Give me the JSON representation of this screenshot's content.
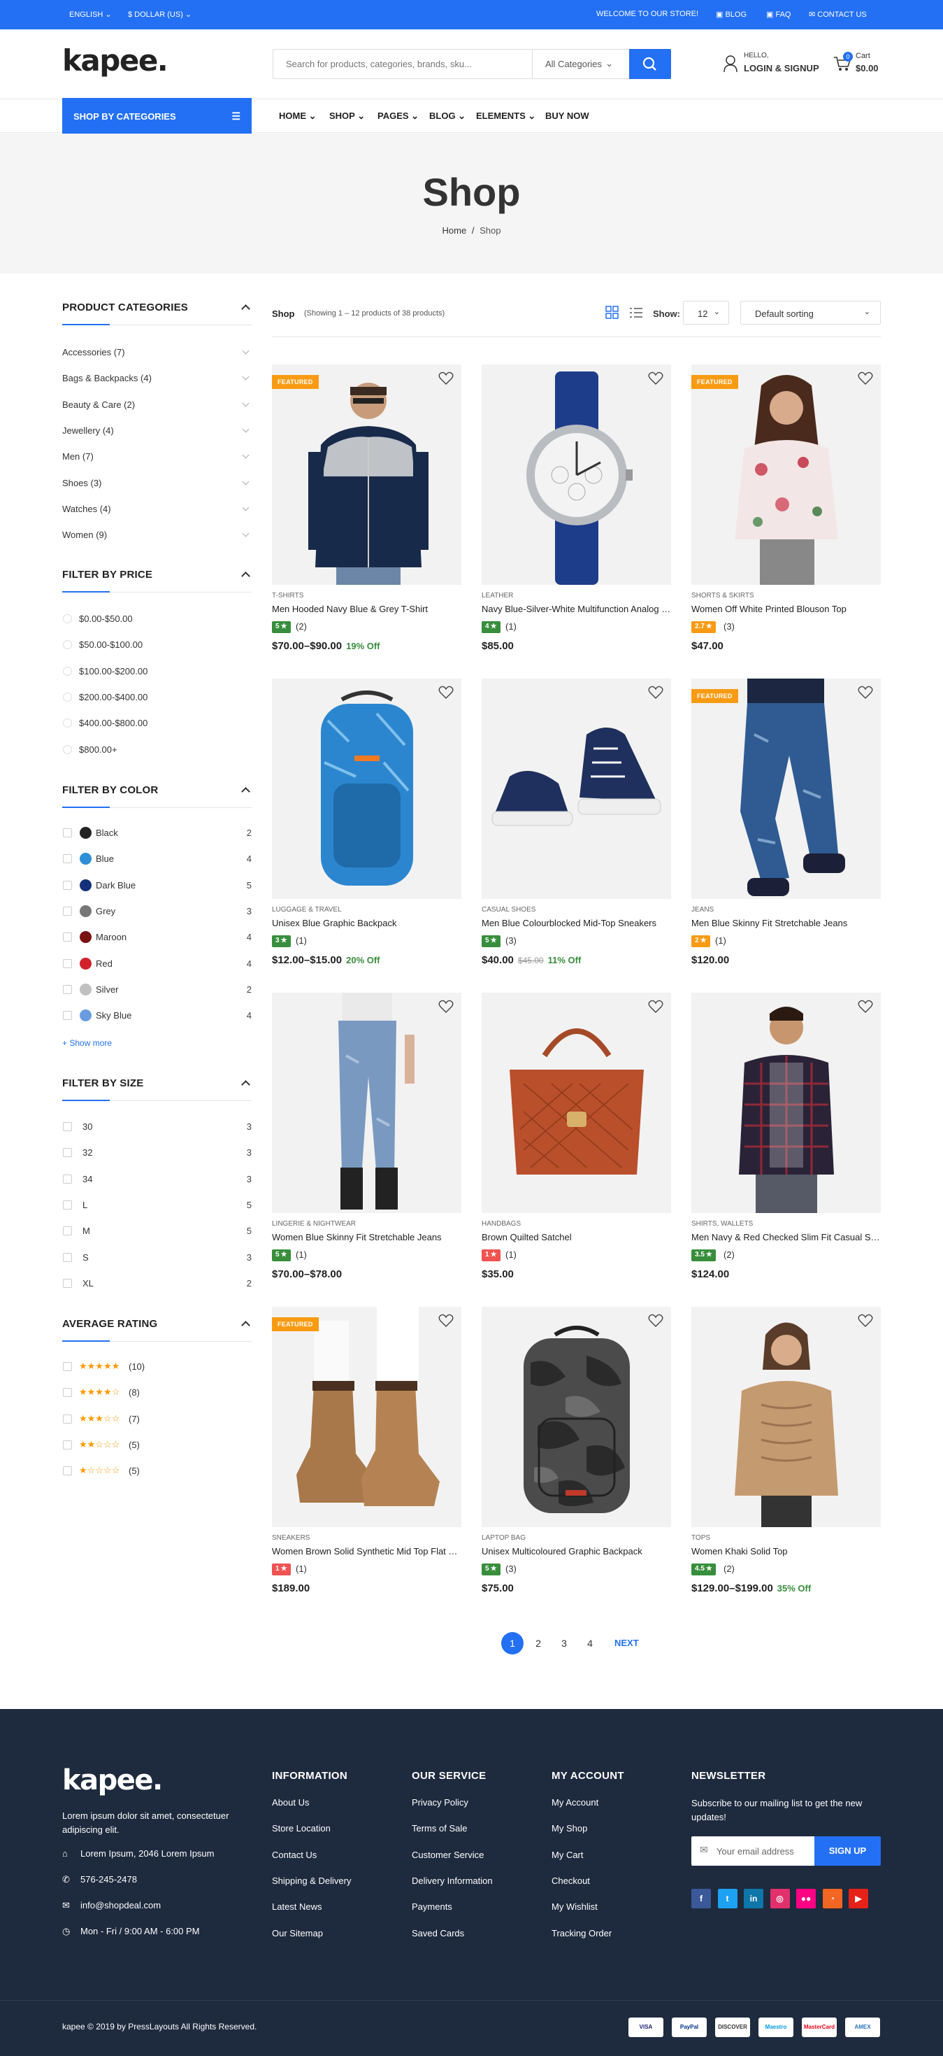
{
  "topbar": {
    "language": "ENGLISH",
    "currency": "$ DOLLAR (US)",
    "welcome": "WELCOME TO OUR STORE!",
    "blog": "BLOG",
    "faq": "FAQ",
    "contact": "CONTACT US"
  },
  "header": {
    "logo": "kapee.",
    "search_placeholder": "Search for products, categories, brands, sku...",
    "search_category": "All Categories",
    "hello": "HELLO,",
    "login": "LOGIN & SIGNUP",
    "cart_label": "Cart",
    "cart_total": "$0.00",
    "cart_count": "0"
  },
  "nav": {
    "shop_by_categories": "SHOP BY CATEGORIES",
    "menu": [
      "HOME",
      "SHOP",
      "PAGES",
      "BLOG",
      "ELEMENTS",
      "BUY NOW"
    ]
  },
  "hero": {
    "title": "Shop",
    "breadcrumb_home": "Home",
    "breadcrumb_sep": "/",
    "breadcrumb_current": "Shop"
  },
  "sidebar": {
    "categories_title": "PRODUCT CATEGORIES",
    "categories": [
      {
        "name": "Accessories",
        "count": "(7)"
      },
      {
        "name": "Bags & Backpacks",
        "count": "(4)"
      },
      {
        "name": "Beauty & Care",
        "count": "(2)"
      },
      {
        "name": "Jewellery",
        "count": "(4)"
      },
      {
        "name": "Men",
        "count": "(7)"
      },
      {
        "name": "Shoes",
        "count": "(3)"
      },
      {
        "name": "Watches",
        "count": "(4)"
      },
      {
        "name": "Women",
        "count": "(9)"
      }
    ],
    "price_title": "FILTER BY PRICE",
    "prices": [
      "$0.00-$50.00",
      "$50.00-$100.00",
      "$100.00-$200.00",
      "$200.00-$400.00",
      "$400.00-$800.00",
      "$800.00+"
    ],
    "color_title": "FILTER BY COLOR",
    "colors": [
      {
        "name": "Black",
        "count": "2",
        "hex": "#222222"
      },
      {
        "name": "Blue",
        "count": "4",
        "hex": "#2e8fd6"
      },
      {
        "name": "Dark Blue",
        "count": "5",
        "hex": "#15307a"
      },
      {
        "name": "Grey",
        "count": "3",
        "hex": "#777777"
      },
      {
        "name": "Maroon",
        "count": "4",
        "hex": "#7a1212"
      },
      {
        "name": "Red",
        "count": "4",
        "hex": "#d1212b"
      },
      {
        "name": "Silver",
        "count": "2",
        "hex": "#c0c0c0"
      },
      {
        "name": "Sky Blue",
        "count": "4",
        "hex": "#6a9de0"
      }
    ],
    "show_more": "+ Show more",
    "size_title": "FILTER BY SIZE",
    "sizes": [
      {
        "name": "30",
        "count": "3"
      },
      {
        "name": "32",
        "count": "3"
      },
      {
        "name": "34",
        "count": "3"
      },
      {
        "name": "L",
        "count": "5"
      },
      {
        "name": "M",
        "count": "5"
      },
      {
        "name": "S",
        "count": "3"
      },
      {
        "name": "XL",
        "count": "2"
      }
    ],
    "rating_title": "AVERAGE RATING",
    "ratings": [
      {
        "stars": 5,
        "count": "(10)"
      },
      {
        "stars": 4,
        "count": "(8)"
      },
      {
        "stars": 3,
        "count": "(7)"
      },
      {
        "stars": 2,
        "count": "(5)"
      },
      {
        "stars": 1,
        "count": "(5)"
      }
    ]
  },
  "toolbar": {
    "title": "Shop",
    "showing": "(Showing 1 – 12 products of 38 products)",
    "show_label": "Show:",
    "per_page": "12",
    "sorting": "Default sorting"
  },
  "products": [
    {
      "category": "T-SHIRTS",
      "name": "Men Hooded Navy Blue & Grey T-Shirt",
      "rating": "5",
      "reviews": "(2)",
      "price": "$70.00–$90.00",
      "old": "",
      "off": "19% Off",
      "featured": "FEATURED",
      "rating_color": "#388e3c"
    },
    {
      "category": "LEATHER",
      "name": "Navy Blue-Silver-White Multifunction Analog Watch",
      "rating": "4",
      "reviews": "(1)",
      "price": "$85.00",
      "old": "",
      "off": "",
      "featured": "",
      "rating_color": "#388e3c"
    },
    {
      "category": "SHORTS & SKIRTS",
      "name": "Women Off White Printed Blouson Top",
      "rating": "2.7",
      "reviews": "(3)",
      "price": "$47.00",
      "old": "",
      "off": "",
      "featured": "FEATURED",
      "rating_color": "#f89b13"
    },
    {
      "category": "LUGGAGE & TRAVEL",
      "name": "Unisex Blue Graphic Backpack",
      "rating": "3",
      "reviews": "(1)",
      "price": "$12.00–$15.00",
      "old": "",
      "off": "20% Off",
      "featured": "",
      "rating_color": "#388e3c"
    },
    {
      "category": "CASUAL SHOES",
      "name": "Men Blue Colourblocked Mid-Top Sneakers",
      "rating": "5",
      "reviews": "(3)",
      "price": "$40.00",
      "old": "$45.00",
      "off": "11% Off",
      "featured": "",
      "rating_color": "#388e3c"
    },
    {
      "category": "JEANS",
      "name": "Men Blue Skinny Fit Stretchable Jeans",
      "rating": "2",
      "reviews": "(1)",
      "price": "$120.00",
      "old": "",
      "off": "",
      "featured": "FEATURED",
      "rating_color": "#f89b13"
    },
    {
      "category": "LINGERIE & NIGHTWEAR",
      "name": "Women Blue Skinny Fit Stretchable Jeans",
      "rating": "5",
      "reviews": "(1)",
      "price": "$70.00–$78.00",
      "old": "",
      "off": "",
      "featured": "",
      "rating_color": "#388e3c"
    },
    {
      "category": "HANDBAGS",
      "name": "Brown Quilted Satchel",
      "rating": "1",
      "reviews": "(1)",
      "price": "$35.00",
      "old": "",
      "off": "",
      "featured": "",
      "rating_color": "#ef5350"
    },
    {
      "category": "SHIRTS, WALLETS",
      "name": "Men Navy & Red Checked Slim Fit Casual Shirt",
      "rating": "3.5",
      "reviews": "(2)",
      "price": "$124.00",
      "old": "",
      "off": "",
      "featured": "",
      "rating_color": "#388e3c"
    },
    {
      "category": "SNEAKERS",
      "name": "Women Brown Solid Synthetic Mid Top Flat Boots",
      "rating": "1",
      "reviews": "(1)",
      "price": "$189.00",
      "old": "",
      "off": "",
      "featured": "FEATURED",
      "rating_color": "#ef5350"
    },
    {
      "category": "LAPTOP BAG",
      "name": "Unisex Multicoloured Graphic Backpack",
      "rating": "5",
      "reviews": "(3)",
      "price": "$75.00",
      "old": "",
      "off": "",
      "featured": "",
      "rating_color": "#388e3c"
    },
    {
      "category": "TOPS",
      "name": "Women Khaki Solid Top",
      "rating": "4.5",
      "reviews": "(2)",
      "price": "$129.00–$199.00",
      "old": "",
      "off": "35% Off",
      "featured": "",
      "rating_color": "#388e3c"
    }
  ],
  "pagination": {
    "pages": [
      "1",
      "2",
      "3",
      "4"
    ],
    "next": "NEXT"
  },
  "footer": {
    "logo": "kapee.",
    "about": "Lorem ipsum dolor sit amet, consectetuer adipiscing elit.",
    "address": "Lorem Ipsum, 2046 Lorem Ipsum",
    "phone": "576-245-2478",
    "email": "info@shopdeal.com",
    "hours": "Mon - Fri / 9:00 AM - 6:00 PM",
    "information_title": "INFORMATION",
    "information": [
      "About Us",
      "Store Location",
      "Contact Us",
      "Shipping & Delivery",
      "Latest News",
      "Our Sitemap"
    ],
    "service_title": "OUR SERVICE",
    "service": [
      "Privacy Policy",
      "Terms of Sale",
      "Customer Service",
      "Delivery Information",
      "Payments",
      "Saved Cards"
    ],
    "account_title": "MY ACCOUNT",
    "account": [
      "My Account",
      "My Shop",
      "My Cart",
      "Checkout",
      "My Wishlist",
      "Tracking Order"
    ],
    "newsletter_title": "NEWSLETTER",
    "newsletter_text": "Subscribe to our mailing list to get the new updates!",
    "email_placeholder": "Your email address",
    "signup": "SIGN UP",
    "social": [
      {
        "icon": "facebook-icon",
        "glyph": "f",
        "color": "#3b5998"
      },
      {
        "icon": "twitter-icon",
        "glyph": "t",
        "color": "#1da1f2"
      },
      {
        "icon": "linkedin-icon",
        "glyph": "in",
        "color": "#0e76a8"
      },
      {
        "icon": "instagram-icon",
        "glyph": "◎",
        "color": "#e1306c"
      },
      {
        "icon": "flickr-icon",
        "glyph": "●●",
        "color": "#ff0084"
      },
      {
        "icon": "rss-icon",
        "glyph": "◔",
        "color": "#f26522"
      },
      {
        "icon": "youtube-icon",
        "glyph": "▶",
        "color": "#e62117"
      }
    ],
    "copyright": "kapee © 2019 by PressLayouts All Rights Reserved.",
    "payments": [
      {
        "label": "VISA",
        "color": "#1a1f71"
      },
      {
        "label": "PayPal",
        "color": "#003087"
      },
      {
        "label": "DISCOVER",
        "color": "#333333"
      },
      {
        "label": "Maestro",
        "color": "#0099df"
      },
      {
        "label": "MasterCard",
        "color": "#eb001b"
      },
      {
        "label": "AMEX",
        "color": "#2e77bc"
      }
    ]
  }
}
